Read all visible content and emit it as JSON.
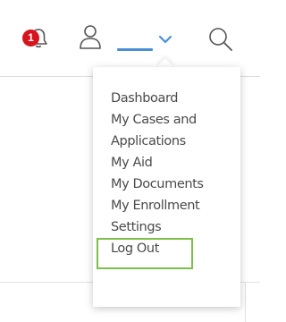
{
  "header": {
    "notifications": {
      "icon": "bell-icon",
      "badge_count": "1",
      "badge_color": "#d7141e"
    },
    "user_icon": "user-icon",
    "account_name": "",
    "dropdown_icon": "chevron-down-icon",
    "search_icon": "search-icon",
    "accent_color": "#4a8fd6"
  },
  "menu": {
    "items": [
      {
        "label": "Dashboard"
      },
      {
        "label": "My Cases and"
      },
      {
        "label": "Applications"
      },
      {
        "label": "My Aid"
      },
      {
        "label": "My Documents"
      },
      {
        "label": "My Enrollment"
      },
      {
        "label": "Settings"
      },
      {
        "label": "Log Out"
      }
    ],
    "highlighted_item": "Settings",
    "highlight_color": "#7cbf4a"
  }
}
